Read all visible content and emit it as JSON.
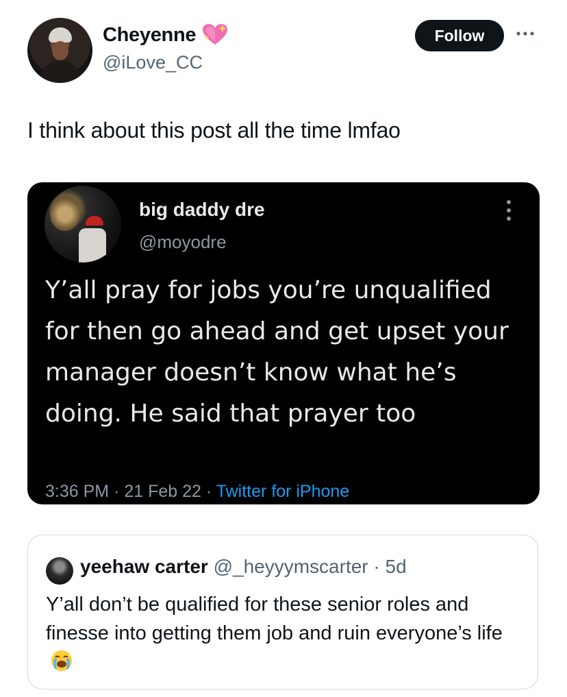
{
  "author": {
    "display_name": "Cheyenne",
    "handle": "@iLove_CC",
    "badge_icon": "sparkling-heart-icon"
  },
  "actions": {
    "follow_label": "Follow",
    "more_icon": "more-horizontal-icon"
  },
  "tweet": {
    "text": "I think about this post all the time lmfao"
  },
  "embedded_screenshot": {
    "author_name": "big daddy dre",
    "author_handle": "@moyodre",
    "text": "Y’all pray for jobs you’re unqualified for then go ahead and get upset your manager doesn’t know what he’s doing. He said that prayer too",
    "time": "3:36 PM",
    "date": "21 Feb 22",
    "source": "Twitter for iPhone",
    "separator": " · ",
    "menu_icon": "more-vertical-icon"
  },
  "quote": {
    "author_name": "yeehaw carter",
    "author_handle": "@_heyyymscarter",
    "separator": " · ",
    "age": "5d",
    "text": "Y’all don’t be qualified for these senior roles and finesse into getting them job and ruin everyone’s life",
    "emoji_icon": "loudly-crying-face-icon"
  },
  "colors": {
    "text_primary": "#0f1419",
    "text_secondary": "#536471",
    "link_blue": "#1d9bf0",
    "dark_card_bg": "#000000",
    "follow_button_bg": "#0f1419"
  }
}
